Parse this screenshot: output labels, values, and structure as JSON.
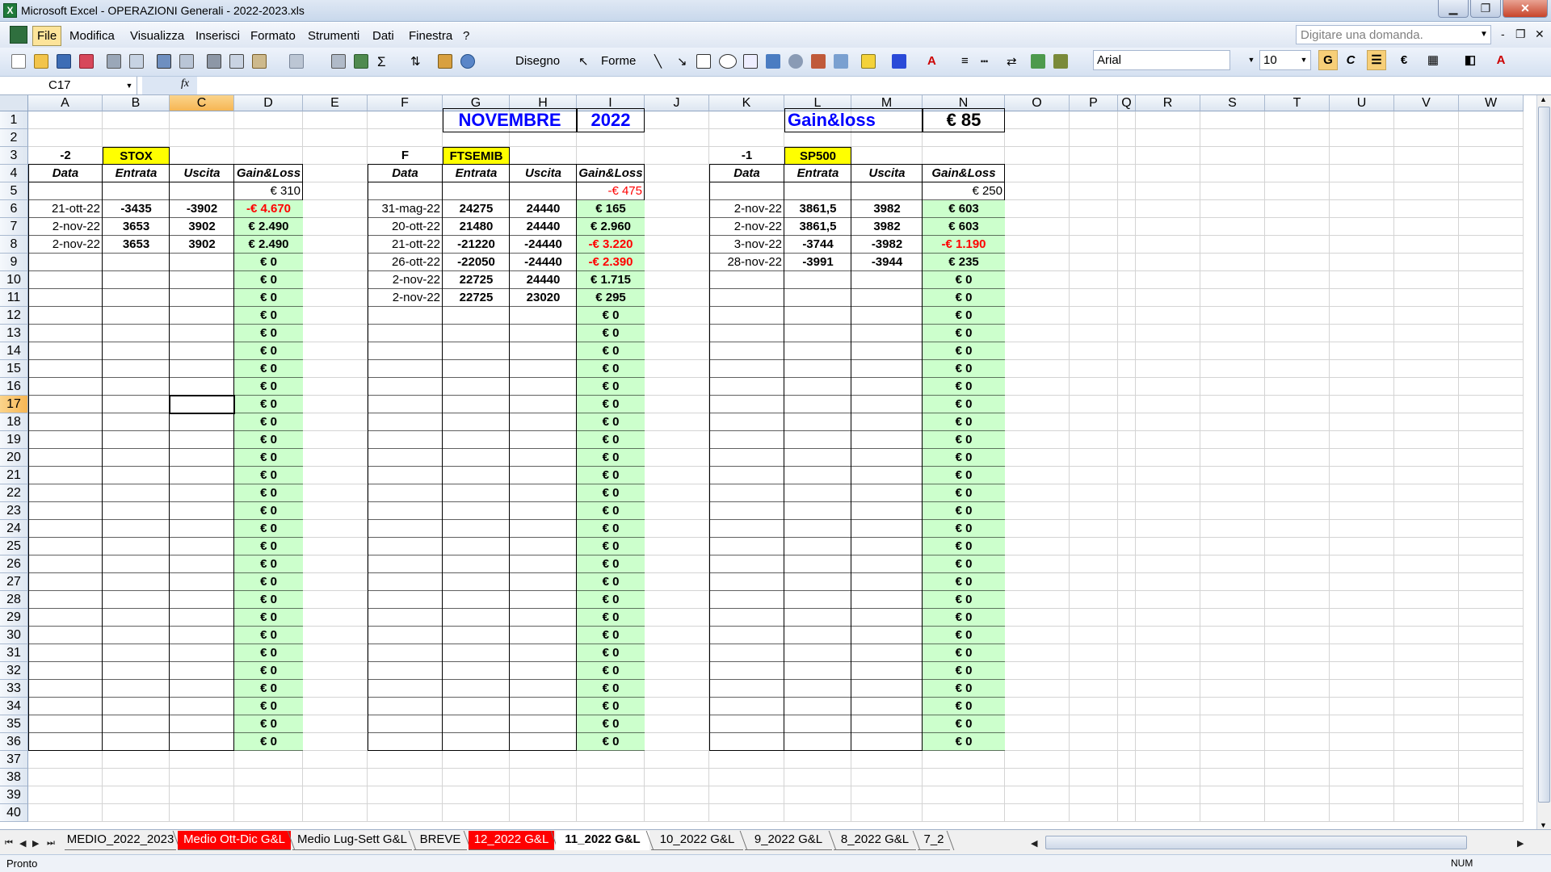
{
  "window": {
    "title": "Microsoft Excel - OPERAZIONI Generali - 2022-2023.xls",
    "min": "▁",
    "max": "❐",
    "close": "✕"
  },
  "menu": {
    "items": [
      "File",
      "Modifica",
      "Visualizza",
      "Inserisci",
      "Formato",
      "Strumenti",
      "Dati",
      "Finestra",
      "?"
    ],
    "ask_placeholder": "Digitare una domanda.",
    "mdi": [
      "-",
      "❐",
      "✕"
    ]
  },
  "toolbar": {
    "disegno": "Disegno",
    "forme": "Forme",
    "font": "Arial",
    "size": "10",
    "bold": "G",
    "italic": "C",
    "euro": "€"
  },
  "formula": {
    "namebox": "C17",
    "fx": "fx",
    "content": ""
  },
  "columns": [
    "A",
    "B",
    "C",
    "D",
    "E",
    "F",
    "G",
    "H",
    "I",
    "J",
    "K",
    "L",
    "M",
    "N",
    "O",
    "P",
    "Q",
    "R",
    "S",
    "T",
    "U",
    "V",
    "W"
  ],
  "rows": [
    "1",
    "2",
    "3",
    "4",
    "5",
    "6",
    "7",
    "8",
    "9",
    "10",
    "11",
    "12",
    "13",
    "14",
    "15",
    "16",
    "17",
    "18",
    "19",
    "20",
    "21",
    "22",
    "23",
    "24",
    "25",
    "26",
    "27",
    "28",
    "29",
    "30",
    "31",
    "32",
    "33",
    "34",
    "35",
    "36",
    "37",
    "38",
    "39",
    "40"
  ],
  "selected": {
    "cell": "C17",
    "col": "C",
    "row": "17"
  },
  "sheet": {
    "month": "NOVEMBRE",
    "year": "2022",
    "gl_label": "Gain&loss",
    "gl_total": "€ 85",
    "headers": {
      "data": "Data",
      "entrata": "Entrata",
      "uscita": "Uscita",
      "gl": "Gain&Loss"
    },
    "zero": "€ 0",
    "stox": {
      "qty": "-2",
      "name": "STOX",
      "prev": "€ 310",
      "rows": [
        [
          "21-ott-22",
          "-3435",
          "-3902",
          "-€ 4.670",
          true
        ],
        [
          "2-nov-22",
          "3653",
          "3902",
          "€ 2.490",
          false
        ],
        [
          "2-nov-22",
          "3653",
          "3902",
          "€ 2.490",
          false
        ]
      ]
    },
    "ftse": {
      "qty": "F",
      "name": "FTSEMIB",
      "prev": "-€ 475",
      "rows": [
        [
          "31-mag-22",
          "24275",
          "24440",
          "€ 165",
          false
        ],
        [
          "20-ott-22",
          "21480",
          "24440",
          "€ 2.960",
          false
        ],
        [
          "21-ott-22",
          "-21220",
          "-24440",
          "-€ 3.220",
          true
        ],
        [
          "26-ott-22",
          "-22050",
          "-24440",
          "-€ 2.390",
          true
        ],
        [
          "2-nov-22",
          "22725",
          "24440",
          "€ 1.715",
          false
        ],
        [
          "2-nov-22",
          "22725",
          "23020",
          "€ 295",
          false
        ]
      ]
    },
    "sp500": {
      "qty": "-1",
      "name": "SP500",
      "prev": "€ 250",
      "rows": [
        [
          "2-nov-22",
          "3861,5",
          "3982",
          "€ 603",
          false
        ],
        [
          "2-nov-22",
          "3861,5",
          "3982",
          "€ 603",
          false
        ],
        [
          "3-nov-22",
          "-3744",
          "-3982",
          "-€ 1.190",
          true
        ],
        [
          "28-nov-22",
          "-3991",
          "-3944",
          "€ 235",
          false
        ]
      ]
    }
  },
  "tabs": [
    {
      "label": "MEDIO_2022_2023",
      "style": "normal"
    },
    {
      "label": "Medio Ott-Dic G&L",
      "style": "red"
    },
    {
      "label": "Medio Lug-Sett G&L",
      "style": "normal"
    },
    {
      "label": "BREVE",
      "style": "normal"
    },
    {
      "label": "12_2022 G&L",
      "style": "red"
    },
    {
      "label": "11_2022 G&L",
      "style": "active"
    },
    {
      "label": "10_2022 G&L",
      "style": "normal"
    },
    {
      "label": "9_2022 G&L",
      "style": "normal"
    },
    {
      "label": "8_2022 G&L",
      "style": "normal"
    },
    {
      "label": "7_2",
      "style": "normal"
    }
  ],
  "status": {
    "ready": "Pronto",
    "num": "NUM"
  },
  "colors": {
    "green": "#ccffcc",
    "yellow": "#ffff00",
    "red": "#ff0000",
    "blue": "#0000ff"
  }
}
